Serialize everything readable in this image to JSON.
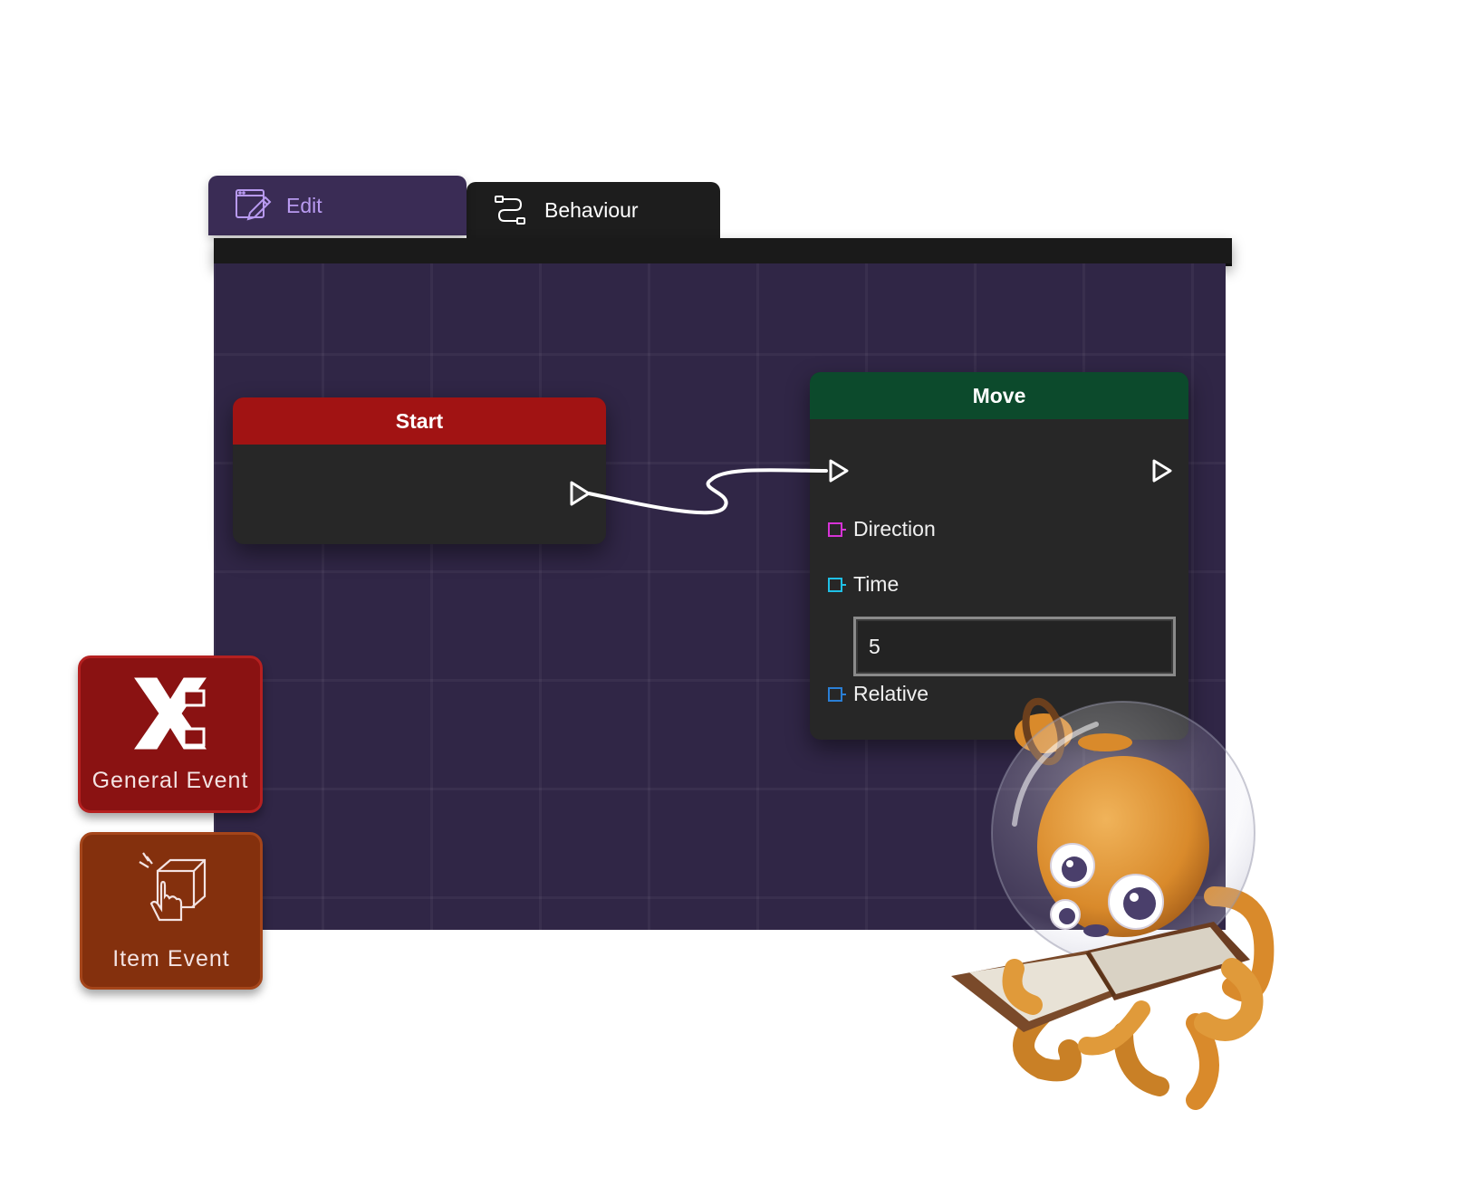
{
  "tabs": {
    "edit": {
      "label": "Edit",
      "icon": "edit-pencil-icon",
      "active": true
    },
    "behaviour": {
      "label": "Behaviour",
      "icon": "flow-connector-icon",
      "active": false
    }
  },
  "nodes": {
    "start": {
      "title": "Start",
      "header_color": "#a11313"
    },
    "move": {
      "title": "Move",
      "header_color": "#0c4a2c",
      "ports": [
        {
          "label": "Direction",
          "color": "#d633d6"
        },
        {
          "label": "Time",
          "color": "#1fc0e6"
        },
        {
          "label": "Relative",
          "color": "#2a7fd6"
        }
      ],
      "time_value": "5"
    }
  },
  "palette": [
    {
      "label": "General Event",
      "icon": "general-event-x-icon",
      "color": "#8a1212"
    },
    {
      "label": "Item Event",
      "icon": "item-event-box-hand-icon",
      "color": "#84300d"
    }
  ],
  "colors": {
    "canvas": "#302646",
    "edit_tab_text": "#b89af0"
  }
}
